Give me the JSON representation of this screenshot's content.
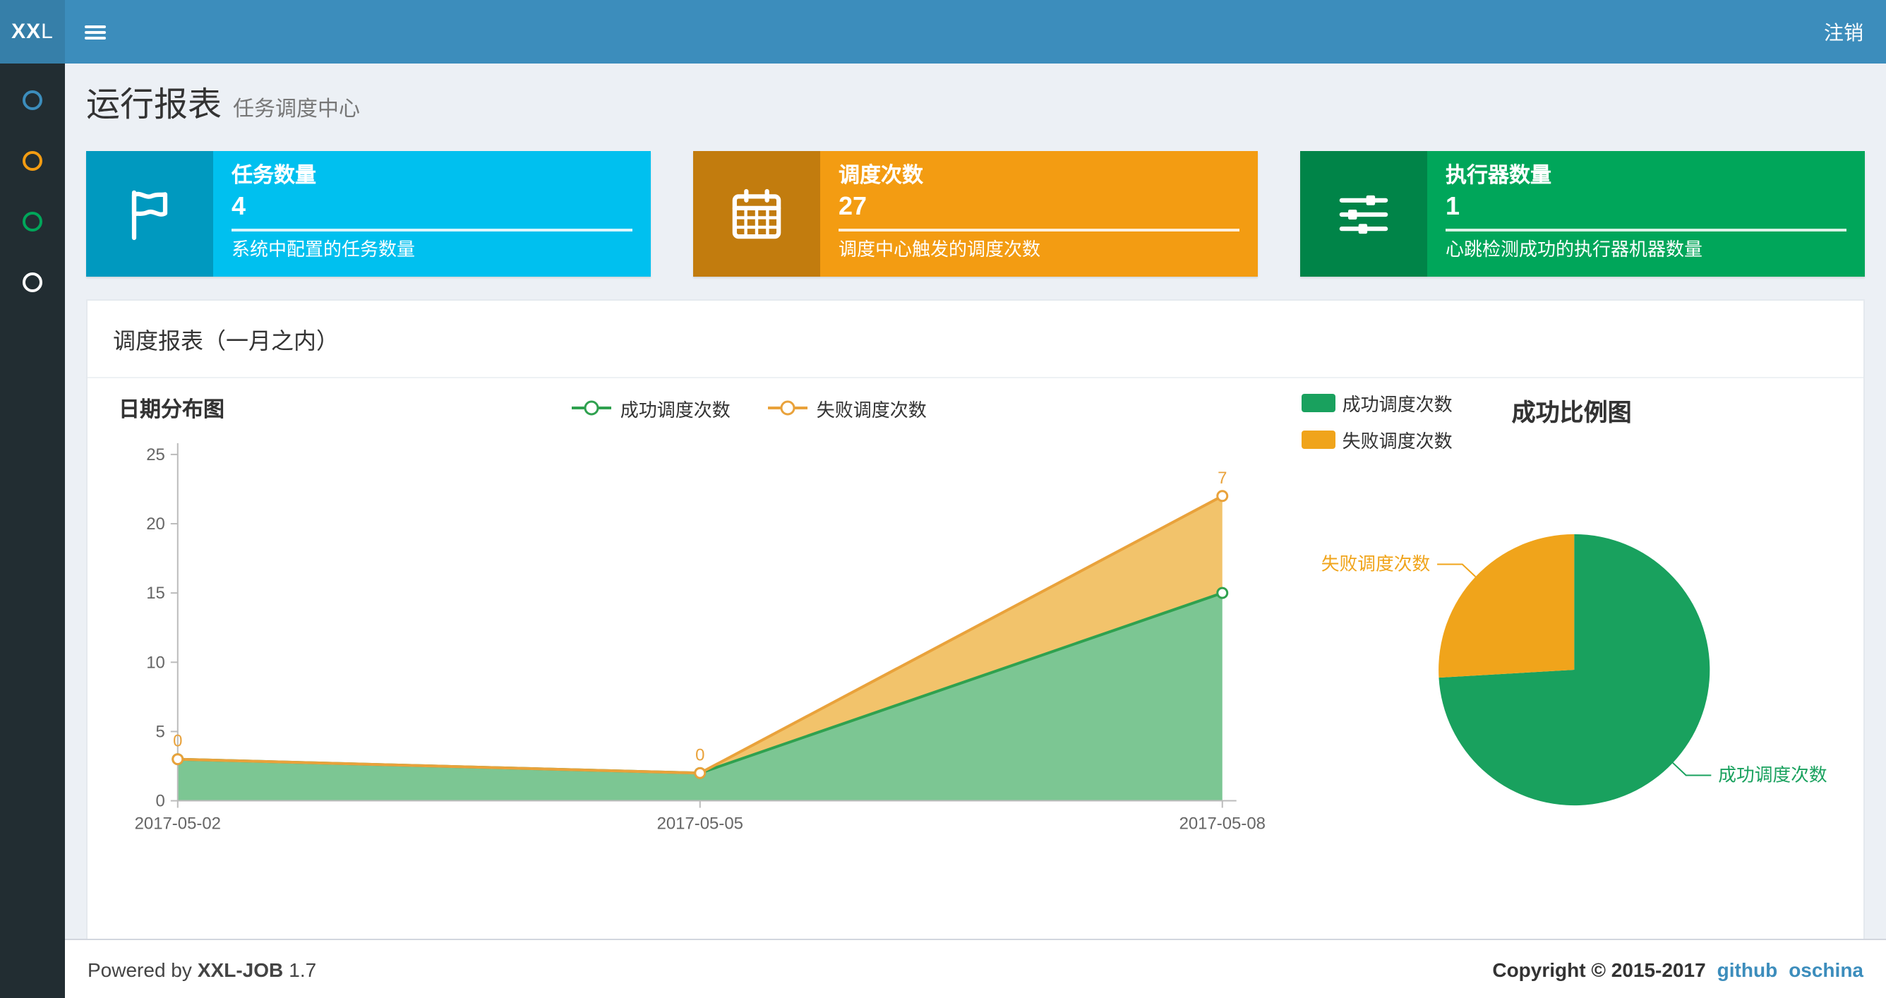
{
  "navbar": {
    "logo_bold": "XX",
    "logo_light": "L",
    "logout": "注销"
  },
  "sidebar": {
    "items": [
      {
        "icon": "circle-icon",
        "color": "#3c8dbc"
      },
      {
        "icon": "circle-icon",
        "color": "#f39c12"
      },
      {
        "icon": "circle-icon",
        "color": "#00a65a"
      },
      {
        "icon": "circle-icon",
        "color": "#ffffff"
      }
    ]
  },
  "header": {
    "title": "运行报表",
    "subtitle": "任务调度中心"
  },
  "info_boxes": [
    {
      "label": "任务数量",
      "value": "4",
      "desc": "系统中配置的任务数量",
      "color": "#00c0ef",
      "icon": "flag-icon"
    },
    {
      "label": "调度次数",
      "value": "27",
      "desc": "调度中心触发的调度次数",
      "color": "#f39c12",
      "icon": "calendar-icon"
    },
    {
      "label": "执行器数量",
      "value": "1",
      "desc": "心跳检测成功的执行器机器数量",
      "color": "#00a65a",
      "icon": "sliders-icon"
    }
  ],
  "panel": {
    "title": "调度报表（一月之内）"
  },
  "chart_data": [
    {
      "type": "area",
      "title": "日期分布图",
      "x": [
        "2017-05-02",
        "2017-05-05",
        "2017-05-08"
      ],
      "series": [
        {
          "name": "成功调度次数",
          "values": [
            3,
            2,
            15
          ],
          "color": "#2FA14F",
          "fill": "#7CC693"
        },
        {
          "name": "失败调度次数",
          "values": [
            0,
            0,
            7
          ],
          "color": "#E9A23B",
          "fill": "#F2C36B",
          "labels": [
            0,
            0,
            7
          ]
        }
      ],
      "stacked": true,
      "ylim": [
        0,
        25
      ],
      "yticks": [
        0,
        5,
        10,
        15,
        20,
        25
      ],
      "grid": false,
      "legend_position": "top-center"
    },
    {
      "type": "pie",
      "title": "成功比例图",
      "slices": [
        {
          "name": "成功调度次数",
          "value": 20,
          "color": "#19A15E"
        },
        {
          "name": "失败调度次数",
          "value": 7,
          "color": "#F0A41B"
        }
      ],
      "legend_position": "top-left"
    }
  ],
  "footer": {
    "powered_prefix": "Powered by",
    "brand": "XXL-JOB",
    "version": "1.7",
    "copyright": "Copyright © 2015-2017",
    "links": [
      "github",
      "oschina"
    ]
  }
}
